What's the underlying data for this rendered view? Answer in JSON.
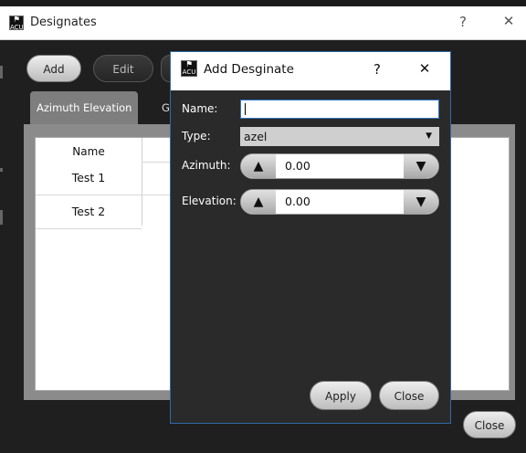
{
  "window": {
    "title": "Designates",
    "help_glyph": "?",
    "close_glyph": "✕",
    "app_icon_text": "ACU"
  },
  "toolbar": {
    "add_label": "Add",
    "edit_label": "Edit"
  },
  "tabs": [
    {
      "label": "Azimuth  Elevation",
      "active": true
    },
    {
      "label": "G",
      "active": false
    }
  ],
  "table": {
    "columns": [
      "Name"
    ],
    "rows": [
      [
        "Test 1"
      ],
      [
        "Test 2"
      ]
    ]
  },
  "footer": {
    "close_label": "Close"
  },
  "dialog": {
    "title": "Add Desginate",
    "help_glyph": "?",
    "close_glyph": "✕",
    "name_label": "Name:",
    "name_value": "",
    "type_label": "Type:",
    "type_value": "azel",
    "azimuth_label": "Azimuth:",
    "azimuth_value": "0.00",
    "elevation_label": "Elevation:",
    "elevation_value": "0.00",
    "apply_label": "Apply",
    "close_label": "Close"
  },
  "colors": {
    "accent_border": "#2f6aa6",
    "field_focus": "#2d77c6",
    "panel_gray": "#8b8b8b",
    "background": "#1f1f1f"
  }
}
